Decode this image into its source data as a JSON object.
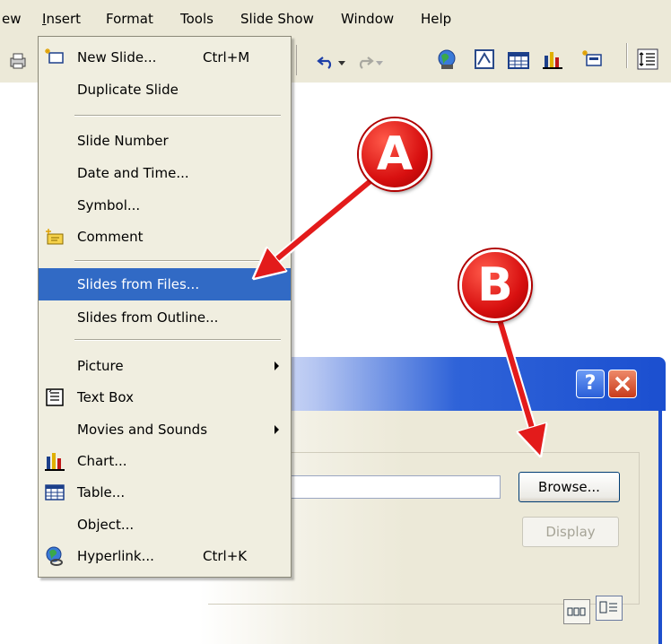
{
  "menubar": {
    "items": [
      {
        "label": "ew"
      },
      {
        "label": "Insert"
      },
      {
        "label": "Format"
      },
      {
        "label": "Tools"
      },
      {
        "label": "Slide Show"
      },
      {
        "label": "Window"
      },
      {
        "label": "Help"
      }
    ]
  },
  "menu": {
    "items": [
      {
        "label": "New Slide...",
        "shortcut": "Ctrl+M",
        "icon": "new-slide-icon"
      },
      {
        "label": "Duplicate Slide"
      },
      {
        "label": "Slide Number"
      },
      {
        "label": "Date and Time..."
      },
      {
        "label": "Symbol..."
      },
      {
        "label": "Comment",
        "icon": "comment-icon"
      },
      {
        "label": "Slides from Files...",
        "selected": true
      },
      {
        "label": "Slides from Outline..."
      },
      {
        "label": "Picture",
        "submenu": true
      },
      {
        "label": "Text Box",
        "icon": "text-box-icon"
      },
      {
        "label": "Movies and Sounds",
        "submenu": true
      },
      {
        "label": "Chart...",
        "icon": "chart-icon"
      },
      {
        "label": "Table...",
        "icon": "table-icon"
      },
      {
        "label": "Object..."
      },
      {
        "label": "Hyperlink...",
        "shortcut": "Ctrl+K",
        "icon": "hyperlink-icon"
      }
    ]
  },
  "dialog": {
    "help_label": "?",
    "browse_label": "Browse...",
    "display_label": "Display",
    "file_value": ""
  },
  "callouts": {
    "a": "A",
    "b": "B"
  },
  "colors": {
    "menu_highlight": "#316ac5",
    "callout_red": "#d81010",
    "title_blue": "#2f63d8"
  }
}
